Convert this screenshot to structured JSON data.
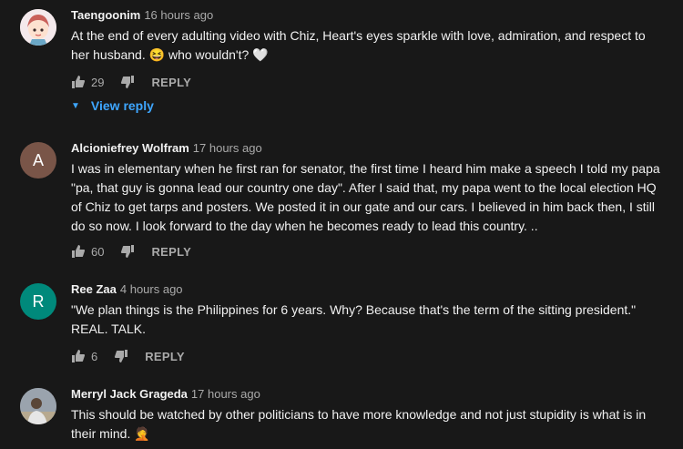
{
  "comments": [
    {
      "author": "Taengoonim",
      "time": "16 hours ago",
      "avatar_letter": "",
      "avatar_color": "#f2e6ea",
      "text_main": "At the end of every adulting video with Chiz, Heart's eyes sparkle with love, admiration, and respect to her husband. ",
      "emoji1": "😆",
      "text_tail": " who wouldn't? ",
      "emoji2": "🤍",
      "likes": "29",
      "reply_label": "REPLY",
      "view_reply_label": "View reply"
    },
    {
      "author": "Alcioniefrey Wolfram",
      "time": "17 hours ago",
      "avatar_letter": "A",
      "avatar_color": "#795548",
      "text_main": "I was in elementary when he first ran for senator, the first time I heard him make a speech I told my papa \"pa, that guy is gonna lead our country one day\". After I said that, my papa went to the local election HQ of Chiz to get tarps and posters. We posted it in our gate and our cars. I believed in him back then, I still do so now. I look forward to the day when he becomes ready to lead this country. ..",
      "likes": "60",
      "reply_label": "REPLY"
    },
    {
      "author": "Ree Zaa",
      "time": "4 hours ago",
      "avatar_letter": "R",
      "avatar_color": "#00897b",
      "text_main": "\"We plan things is the Philippines for 6 years. Why? Because that's the term of the sitting president.\" REAL. TALK.",
      "likes": "6",
      "reply_label": "REPLY"
    },
    {
      "author": "Merryl Jack Grageda",
      "time": "17 hours ago",
      "avatar_letter": "",
      "avatar_color": "#8a8f96",
      "text_main": "This should be watched by other politicians to have more knowledge and not just stupidity is what is in their mind. ",
      "emoji1": "🤦"
    }
  ]
}
